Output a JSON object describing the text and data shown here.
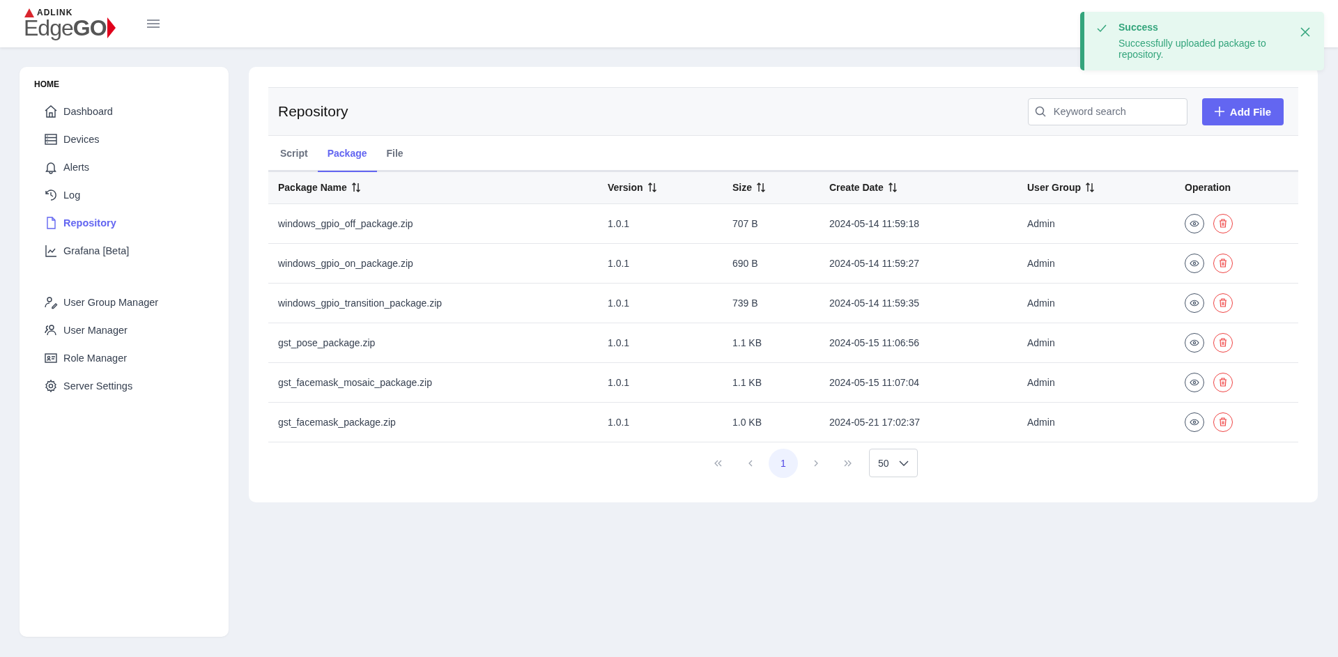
{
  "header": {
    "brand": "ADLINK",
    "product": "Edge**GO**"
  },
  "toast": {
    "title": "Success",
    "message": "Successfully uploaded package to repository."
  },
  "sidebar": {
    "section": "HOME",
    "items": [
      {
        "label": "Dashboard",
        "selected": false
      },
      {
        "label": "Devices",
        "selected": false
      },
      {
        "label": "Alerts",
        "selected": false
      },
      {
        "label": "Log",
        "selected": false
      },
      {
        "label": "Repository",
        "selected": true
      },
      {
        "label": "Grafana [Beta]",
        "selected": false
      }
    ],
    "admin_items": [
      {
        "label": "User Group Manager",
        "selected": false
      },
      {
        "label": "User Manager",
        "selected": false
      },
      {
        "label": "Role Manager",
        "selected": false
      },
      {
        "label": "Server Settings",
        "selected": false
      }
    ]
  },
  "panel": {
    "title": "Repository",
    "search": {
      "placeholder": "Keyword search"
    },
    "add_button": "Add File"
  },
  "tabs": [
    {
      "label": "Script",
      "selected": false
    },
    {
      "label": "Package",
      "selected": true
    },
    {
      "label": "File",
      "selected": false
    }
  ],
  "table": {
    "columns": [
      {
        "label": "Package Name",
        "sortable": true
      },
      {
        "label": "Version",
        "sortable": true
      },
      {
        "label": "Size",
        "sortable": true
      },
      {
        "label": "Create Date",
        "sortable": true
      },
      {
        "label": "User Group",
        "sortable": true
      },
      {
        "label": "Operation",
        "sortable": false
      }
    ],
    "rows": [
      [
        "windows_gpio_off_package.zip",
        "1.0.1",
        "707 B",
        "2024-05-14 11:59:18",
        "Admin"
      ],
      [
        "windows_gpio_on_package.zip",
        "1.0.1",
        "690 B",
        "2024-05-14 11:59:27",
        "Admin"
      ],
      [
        "windows_gpio_transition_package.zip",
        "1.0.1",
        "739 B",
        "2024-05-14 11:59:35",
        "Admin"
      ],
      [
        "gst_pose_package.zip",
        "1.0.1",
        "1.1 KB",
        "2024-05-15 11:06:56",
        "Admin"
      ],
      [
        "gst_facemask_mosaic_package.zip",
        "1.0.1",
        "1.1 KB",
        "2024-05-15 11:07:04",
        "Admin"
      ],
      [
        "gst_facemask_package.zip",
        "1.0.1",
        "1.0 KB",
        "2024-05-21 17:02:37",
        "Admin"
      ]
    ]
  },
  "pagination": {
    "pages": [
      {
        "label": "1",
        "selected": true
      }
    ],
    "page_size": "50"
  }
}
